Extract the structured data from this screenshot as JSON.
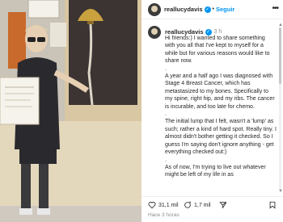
{
  "post": {
    "username": "reallucydavis",
    "verified_glyph": "✓",
    "separator": "•",
    "follow_label": "Seguir",
    "time_ago": "3 h",
    "caption": "Hi friends:) I wanted to share something with you all that I've kept to myself for a while but for various reasons would like to share now.\n.\nA year and a half ago I was diagnosed with Stage 4 Breast Cancer, which has metastasized to my bones. Specifically to my spine, right hip, and my ribs. The cancer is incurable, and too late for chemo.\n.\nThe initial lump that I felt, wasn't a 'lump' as such; rather a kind of hard spot. Really tiny. I almost didn't bother getting it checked. So I guess I'm saying don't ignore anything - get everything checked out:)\n.\nAs of now, I'm trying to live out whatever might be left of my life in as",
    "likes": "31,1 mil",
    "comments": "1,7 mil",
    "footer_time": "Hace 3 horas"
  },
  "icons": {
    "more": "more-icon",
    "like": "heart-icon",
    "comment": "comment-icon",
    "share": "share-icon",
    "save": "bookmark-icon"
  },
  "colors": {
    "accent": "#0095f6",
    "text": "#262626",
    "muted": "#8e8e8e"
  }
}
